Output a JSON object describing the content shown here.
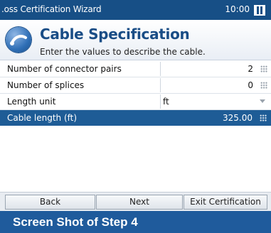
{
  "window": {
    "title": ".oss Certification Wizard",
    "clock": "10:00"
  },
  "header": {
    "title": "Cable Specification",
    "subtitle": "Enter the values to describe the cable."
  },
  "fields": [
    {
      "label": "Number of connector pairs",
      "value": "2",
      "control": "keypad-icon"
    },
    {
      "label": "Number of splices",
      "value": "0",
      "control": "keypad-icon"
    },
    {
      "label": "Length unit",
      "value": "ft",
      "control": "dropdown-arrow-icon"
    },
    {
      "label": "Cable length (ft)",
      "value": "325.00",
      "control": "keypad-icon",
      "selected": true
    }
  ],
  "buttons": {
    "back": "Back",
    "next": "Next",
    "exit": "Exit Certification"
  },
  "caption": "Screen Shot of Step 4",
  "colors": {
    "titlebar": "#174f86",
    "selected_row": "#1e5c96",
    "caption_bar": "#1f5b9c",
    "header_title": "#1a4d86"
  }
}
